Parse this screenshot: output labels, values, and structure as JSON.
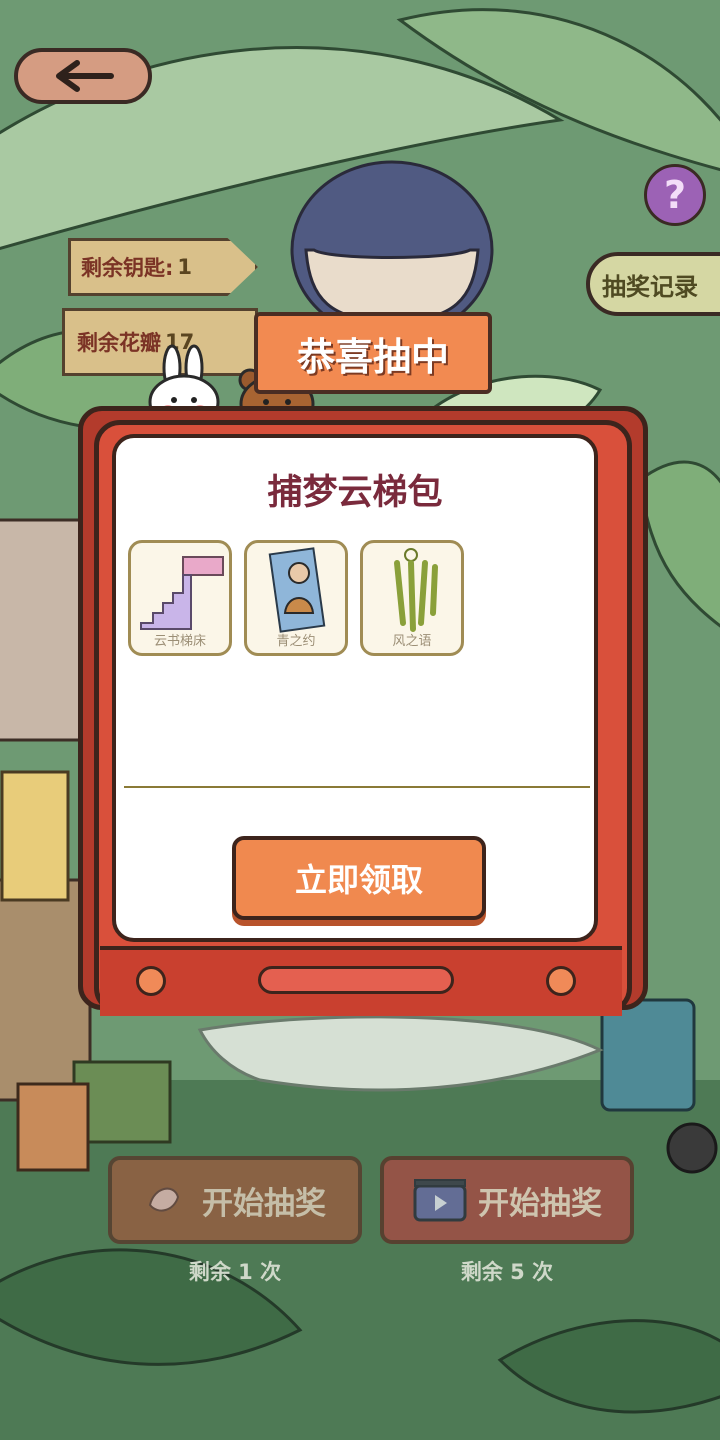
{
  "nav": {
    "back_icon": "back-arrow-icon",
    "help_label": "?",
    "record_label": "抽奖记录"
  },
  "signs": {
    "keys_label": "剩余钥匙:",
    "keys_count": "1",
    "petals_label": "剩余花瓣",
    "petals_count": "17"
  },
  "banner": {
    "title": "恭喜抽中"
  },
  "reward": {
    "title": "捕梦云梯包",
    "items": [
      {
        "name": "云书梯床",
        "icon": "book-stair-bed-icon"
      },
      {
        "name": "青之约",
        "icon": "poster-icon"
      },
      {
        "name": "风之语",
        "icon": "wind-chime-icon"
      }
    ],
    "claim_label": "立即领取"
  },
  "draw": {
    "petal_button_label": "开始抽奖",
    "petal_remaining": "剩余 1 次",
    "video_button_label": "开始抽奖",
    "video_remaining": "剩余 5 次"
  },
  "colors": {
    "tv_red": "#d9503b",
    "claim_orange": "#f0894f",
    "title_wine": "#7a2a3c",
    "help_purple": "#9c62b5"
  }
}
